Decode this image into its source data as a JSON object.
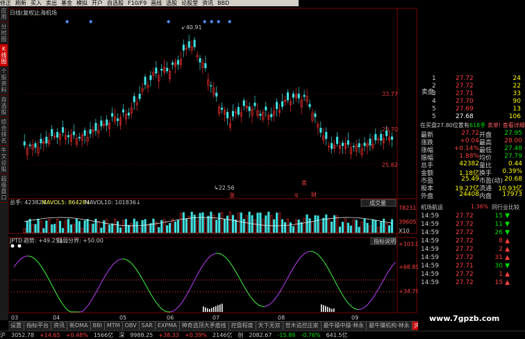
{
  "toolbar": {
    "items": [
      "修正",
      "刷新",
      "买入",
      "卖出",
      "基金",
      "模拟",
      "开户",
      "自选股",
      "F10/F9",
      "画线",
      "选股",
      "论股堂",
      "资讯",
      "BBD"
    ]
  },
  "sidebar": {
    "tabs": [
      "应用",
      "分时图",
      "K线图",
      "个股资料",
      "自选股",
      "综合排名",
      "牛叉诊股",
      "超级盘口"
    ],
    "active_index": 2
  },
  "chart_header": {
    "period": "日线(复权)",
    "market": "上海机场"
  },
  "price_axis": [
    "33.77",
    "29.70",
    "25.62"
  ],
  "price_annotations": {
    "high": "40.91",
    "low": "22.56"
  },
  "markers": {
    "sell": "卖",
    "q": "q",
    "cai": "财",
    "zhang": "涨"
  },
  "volume": {
    "label_total": "总手: 42382↓",
    "ma5": "MAVOL5: 86428↓",
    "ma10": "MAVOL10: 101836↓",
    "button": "成交量",
    "axis_top": "78231",
    "axis_mid": "39605",
    "axis_unit": "X10"
  },
  "indicator": {
    "name": "JPTD",
    "trend": "趋势: +49.25↓",
    "split": "强弱分界: +50.00",
    "button": "指标说明",
    "axis": [
      "+103.0",
      "+68.89",
      "+34.79"
    ]
  },
  "xaxis": {
    "labels": [
      "03",
      "04",
      "05",
      "06",
      "07",
      "08",
      "09"
    ]
  },
  "order_book": {
    "sell_label": "卖盘",
    "asks": [
      {
        "level": "5",
        "price": "27.69",
        "vol": "13"
      },
      {
        "level": "4",
        "price": "27.70",
        "vol": "90"
      },
      {
        "level": "3",
        "price": "27.71",
        "vol": "33"
      },
      {
        "level": "2",
        "price": "27.72",
        "vol": "22"
      },
      {
        "level": "1",
        "price": "27.72",
        "vol": "24"
      }
    ],
    "bid1": {
      "level": "5",
      "price": "27.68",
      "vol": "106"
    }
  },
  "quote_header": {
    "left": "在买盘27.80位置有",
    "mid": "618手",
    "right": "卖单! 查看详细"
  },
  "quote": [
    {
      "l1": "最新",
      "v1": "27.72",
      "l2": "开盘",
      "v2": "27.95"
    },
    {
      "l1": "涨跌",
      "v1": "+0.04",
      "l2": "最高",
      "v2": "28.00"
    },
    {
      "l1": "涨幅",
      "v1": "+0.14%",
      "l2": "最低",
      "v2": "27.48"
    },
    {
      "l1": "振幅",
      "v1": "1.88%",
      "l2": "均价",
      "v2": "27.79"
    },
    {
      "l1": "总手",
      "v1": "42382",
      "l2": "量比",
      "v2": "0.44"
    },
    {
      "l1": "金额",
      "v1": "1.18亿",
      "l2": "换手",
      "v2": "0.39%"
    },
    {
      "l1": "市盈",
      "v1": "25.49",
      "l2": "市盈(动)",
      "v2": "20.68"
    },
    {
      "l1": "股本",
      "v1": "19.27亿",
      "l2": "流通",
      "v2": "10.93亿"
    },
    {
      "l1": "外盘",
      "v1": "24408",
      "l2": "内盘",
      "v2": "17973"
    }
  ],
  "trades_header": {
    "title": "机场航运",
    "pct": "1.36%",
    "btn": "同行业比较"
  },
  "trades": [
    {
      "time": "14:59",
      "price": "27.72",
      "vol": "15",
      "dir": "down"
    },
    {
      "time": "14:59",
      "price": "27.72",
      "vol": "11",
      "dir": "down"
    },
    {
      "time": "14:59",
      "price": "27.72",
      "vol": "26",
      "dir": "down"
    },
    {
      "time": "14:59",
      "price": "27.72",
      "vol": "8",
      "dir": "up"
    },
    {
      "time": "14:59",
      "price": "27.72",
      "vol": "2",
      "dir": "up"
    },
    {
      "time": "14:59",
      "price": "27.72",
      "vol": "31",
      "dir": "up"
    },
    {
      "time": "14:59",
      "price": "27.71",
      "vol": "30",
      "dir": "down"
    },
    {
      "time": "14:59",
      "price": "27.72",
      "vol": "1",
      "dir": "up"
    },
    {
      "time": "14:59",
      "price": "27.72",
      "vol": "15",
      "dir": "up"
    }
  ],
  "bottom_tabs": {
    "items": [
      "设置",
      "指标平台",
      "资讯",
      "新DMA",
      "BBI",
      "MTM",
      "OBV",
      "SAR",
      "EXPMA",
      "神奇选顶大矛盾线",
      "控盘程度",
      "天下无双",
      "世木追控庄家",
      "最牛操中操·林永",
      "最牛赚机构·林永",
      "JPTD"
    ],
    "active_index": 15
  },
  "status": {
    "items": [
      "沪",
      "3052.78",
      "+14.65",
      "+0.48%",
      "1566亿",
      "深",
      "9988.25",
      "+38.33",
      "+0.39%",
      "2146亿",
      "创",
      "2082.67",
      "-15.89",
      "-0.76%",
      "641.5亿"
    ]
  },
  "watermark": "www.7gpzb.com",
  "colors": {
    "up": "#ff3030",
    "down": "#40e0e0",
    "accent_red": "#c00000"
  }
}
